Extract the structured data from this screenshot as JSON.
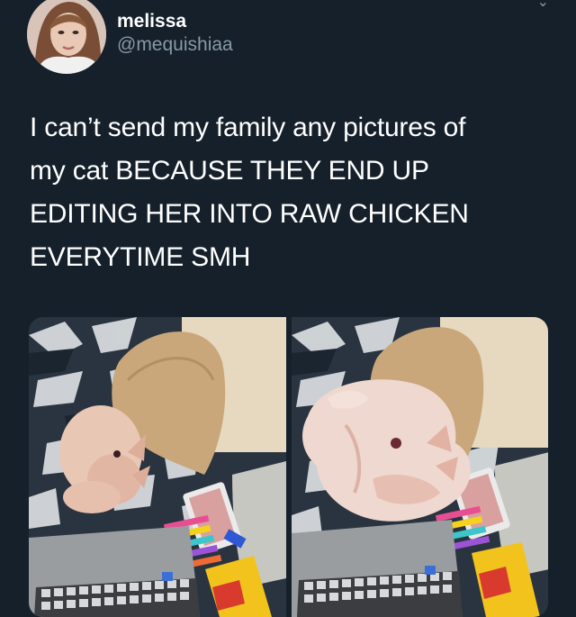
{
  "tweet": {
    "display_name": "melissa",
    "handle": "@mequishiaa",
    "text": "I can’t send my family any pictures of my cat BECAUSE THEY END UP EDITING HER INTO RAW CHICKEN EVERYTIME SMH",
    "lines": [
      "I can’t send my family any pictures of",
      "my cat BECAUSE THEY END UP",
      "EDITING HER INTO RAW CHICKEN",
      "EVERYTIME SMH"
    ],
    "more_icon": "chevron-down-icon"
  },
  "colors": {
    "background": "#15202b",
    "text": "#ffffff",
    "secondary": "#8899a6"
  }
}
